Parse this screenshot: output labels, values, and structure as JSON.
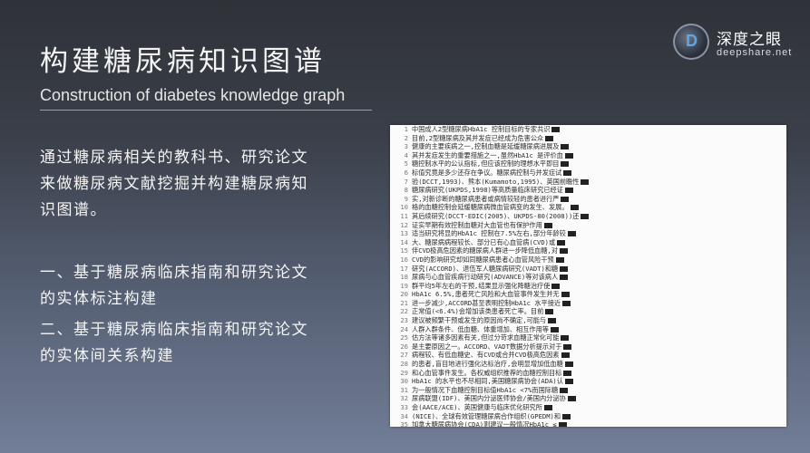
{
  "slide": {
    "title": "构建糖尿病知识图谱",
    "subtitle": "Construction of diabetes knowledge graph"
  },
  "brand": {
    "logo_letter": "D",
    "name_cn": "深度之眼",
    "url": "deepshare.net"
  },
  "body": {
    "para1": "通过糖尿病相关的教科书、研究论文来做糖尿病文献挖掘并构建糖尿病知识图谱。",
    "para2": "一、基于糖尿病临床指南和研究论文的实体标注构建",
    "para3": "二、基于糖尿病临床指南和研究论文的实体间关系构建"
  },
  "document": {
    "lines": [
      {
        "n": "1",
        "t": "中国成人2型糖尿病HbA1c  控制目标的专家共识"
      },
      {
        "n": "2",
        "t": "目前,2型糖尿病及其并发症已经成为危害公众"
      },
      {
        "n": "3",
        "t": "健康的主要疾病之一,控制血糖是延缓糖尿病进展及"
      },
      {
        "n": "4",
        "t": "其并发症发生的重要措施之一,虽然HbA1c  是评价血"
      },
      {
        "n": "5",
        "t": "糖控制水平的公认指标,但应该控制的理想水平即目"
      },
      {
        "n": "6",
        "t": "标值究竟是多少还存在争议。糖尿病控制与并发症试"
      },
      {
        "n": "7",
        "t": "验(DCCT,1993)、熊本(Kumamoto,1995)、英国前瞻性"
      },
      {
        "n": "8",
        "t": "糖尿病研究(UKPDS,1998)等高质量临床研究已经证"
      },
      {
        "n": "9",
        "t": "实,对新诊断的糖尿病患者或病情较轻的患者进行严"
      },
      {
        "n": "10",
        "t": "格的血糖控制会延缓糖尿病微血管病变的发生、发展。"
      },
      {
        "n": "11",
        "t": "其后续研究(DCCT-EDIC(2005)、UKPDS-80(2008))还"
      },
      {
        "n": "12",
        "t": "证实早期有效控制血糖对大血管也有保护作用"
      },
      {
        "n": "13",
        "t": "适当研究将显的HbA1c  控制在7.5%左右,部分年龄较"
      },
      {
        "n": "14",
        "t": "大、糖尿病病程较长、部分已有心血管病(CVD)或"
      },
      {
        "n": "15",
        "t": "伴CVD极高危因素的糖尿病人群进一步降低血糖,对"
      },
      {
        "n": "16",
        "t": "CVD的影响研究却如同糖尿病患者心血管风险干预"
      },
      {
        "n": "17",
        "t": "研究(ACCORD)、退伍军人糖尿病研究(VADT)和糖"
      },
      {
        "n": "18",
        "t": "尿病与心血管疾病行动研究(ADVANCE)等对该病人"
      },
      {
        "n": "19",
        "t": "群平均5年左右的干预,结果显示强化降糖治疗使"
      },
      {
        "n": "20",
        "t": "HbA1c  6.5%,患者死亡风险和大血管事件发生并无"
      },
      {
        "n": "21",
        "t": "进一步减少,ACCORD甚至表明控制HbA1c  水平接近"
      },
      {
        "n": "22",
        "t": "正常值(<6.4%)会增加该类患者死亡率。目前"
      },
      {
        "n": "23",
        "t": "建议被频繁干预或发生的原因尚不确定,可能与"
      },
      {
        "n": "24",
        "t": "人群入群条件、低血糖、体重增加、相互作用等"
      },
      {
        "n": "25",
        "t": "估方法等诸多因素有关,但过分苛求血糖正常化可能"
      },
      {
        "n": "26",
        "t": "是主要原因之一。ACCORD、VADT数据分析提示对于"
      },
      {
        "n": "27",
        "t": "病程较、有低血糖史、有CVD或合并CVD极高危因素"
      },
      {
        "n": "28",
        "t": "的患者,盲目地进行强化达标治疗,会明显增加低血糖"
      },
      {
        "n": "29",
        "t": "和心血管事件发生。各权威组织推荐的血糖控制目标"
      },
      {
        "n": "30",
        "t": "HbA1c  的水平也不尽相同,美国糖尿病协会(ADA)认"
      },
      {
        "n": "31",
        "t": "为一般情况下血糖控制目标值HbA1c  <7%而国际糖"
      },
      {
        "n": "32",
        "t": "尿病联盟(IDF)、美国内分泌医师协会/美国内分泌协"
      },
      {
        "n": "33",
        "t": "会(AACE/ACE)、英国健康与临床优化研究所"
      },
      {
        "n": "34",
        "t": "(NICE)、全球有效管理糖尿病合作组织(GPEDM)和"
      },
      {
        "n": "35",
        "t": "加拿大糖尿病协会(CDA)则建议一般情况HbA1c  ≤"
      },
      {
        "n": "36",
        "t": "6.5%[10-14];中华医学会糖尿病分会推荐的一般HbA1c"
      },
      {
        "n": "37",
        "t": "目标值为<6.5%。"
      }
    ]
  }
}
